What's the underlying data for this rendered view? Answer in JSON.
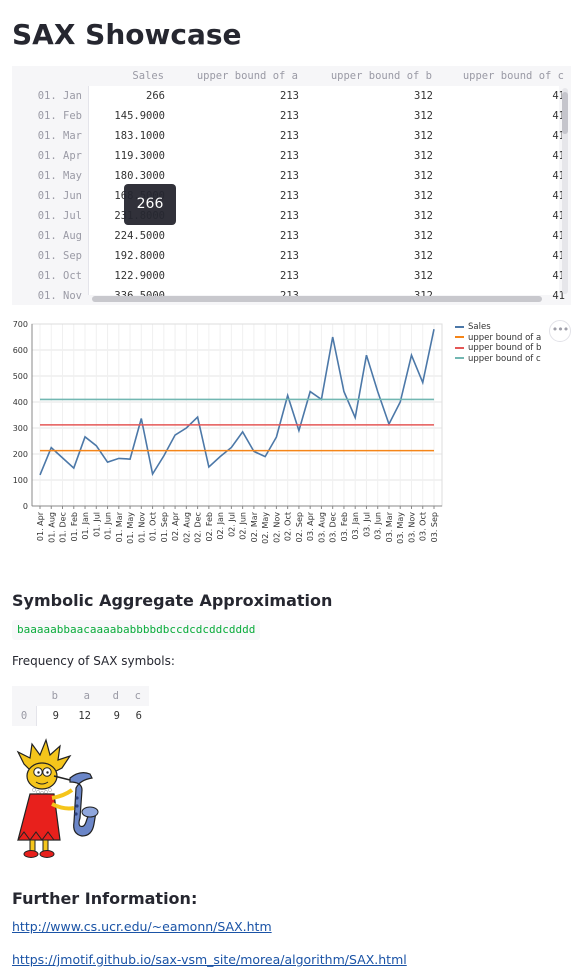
{
  "page": {
    "title": "SAX Showcase"
  },
  "dataframe": {
    "columns": [
      "Sales",
      "upper bound of a",
      "upper bound of b",
      "upper bound of c"
    ],
    "rows": [
      {
        "index": "01. Jan",
        "cells": [
          "266",
          "213",
          "312",
          "41"
        ]
      },
      {
        "index": "01. Feb",
        "cells": [
          "145.9000",
          "213",
          "312",
          "41"
        ]
      },
      {
        "index": "01. Mar",
        "cells": [
          "183.1000",
          "213",
          "312",
          "41"
        ]
      },
      {
        "index": "01. Apr",
        "cells": [
          "119.3000",
          "213",
          "312",
          "41"
        ]
      },
      {
        "index": "01. May",
        "cells": [
          "180.3000",
          "213",
          "312",
          "41"
        ]
      },
      {
        "index": "01. Jun",
        "cells": [
          "168.5000",
          "213",
          "312",
          "41"
        ]
      },
      {
        "index": "01. Jul",
        "cells": [
          "231.8000",
          "213",
          "312",
          "41"
        ]
      },
      {
        "index": "01. Aug",
        "cells": [
          "224.5000",
          "213",
          "312",
          "41"
        ]
      },
      {
        "index": "01. Sep",
        "cells": [
          "192.8000",
          "213",
          "312",
          "41"
        ]
      },
      {
        "index": "01. Oct",
        "cells": [
          "122.9000",
          "213",
          "312",
          "41"
        ]
      },
      {
        "index": "01. Nov",
        "cells": [
          "336.5000",
          "213",
          "312",
          "41"
        ]
      }
    ],
    "tooltip": "266"
  },
  "chart_data": {
    "type": "line",
    "x": [
      "01. Jan",
      "01. Feb",
      "01. Mar",
      "01. Apr",
      "01. May",
      "01. Jun",
      "01. Jul",
      "01. Aug",
      "01. Sep",
      "01. Oct",
      "01. Nov",
      "01. Dec",
      "02. Jan",
      "02. Feb",
      "02. Mar",
      "02. Apr",
      "02. May",
      "02. Jun",
      "02. Jul",
      "02. Aug",
      "02. Sep",
      "02. Oct",
      "02. Nov",
      "02. Dec",
      "03. Jan",
      "03. Feb",
      "03. Mar",
      "03. Apr",
      "03. May",
      "03. Jun",
      "03. Jul",
      "03. Aug",
      "03. Sep",
      "03. Oct",
      "03. Nov",
      "03. Dec"
    ],
    "xtick_labels": [
      "01. Apr",
      "01. Aug",
      "01. Dec",
      "01. Feb",
      "01. Jan",
      "01. Jul",
      "01. Jun",
      "01. Mar",
      "01. May",
      "01. Nov",
      "01. Oct",
      "01. Sep",
      "02. Apr",
      "02. Aug",
      "02. Dec",
      "02. Feb",
      "02. Jan",
      "02. Jul",
      "02. Jun",
      "02. Mar",
      "02. May",
      "02. Nov",
      "02. Oct",
      "02. Sep",
      "03. Apr",
      "03. Aug",
      "03. Dec",
      "03. Feb",
      "03. Jan",
      "03. Jul",
      "03. Jun",
      "03. Mar",
      "03. May",
      "03. Nov",
      "03. Oct",
      "03. Sep"
    ],
    "ylim": [
      0,
      700
    ],
    "yticks": [
      0,
      100,
      200,
      300,
      400,
      500,
      600,
      700
    ],
    "grid": true,
    "legend_position": "top-right",
    "series": [
      {
        "name": "Sales",
        "color": "#4c78a8",
        "values": [
          119.3,
          224.5,
          185,
          145.9,
          266,
          231.8,
          168.5,
          183.1,
          180.3,
          336.5,
          122.9,
          192.8,
          273,
          300,
          342,
          150,
          190,
          225,
          285,
          210,
          190,
          265,
          425,
          290,
          440,
          410,
          650,
          440,
          340,
          580,
          440,
          315,
          400,
          580,
          475,
          680
        ]
      },
      {
        "name": "upper bound of a",
        "color": "#f58518",
        "values": [
          213
        ]
      },
      {
        "name": "upper bound of b",
        "color": "#e45756",
        "values": [
          312
        ]
      },
      {
        "name": "upper bound of c",
        "color": "#72b7b2",
        "values": [
          410
        ]
      }
    ]
  },
  "sax": {
    "heading": "Symbolic Aggregate Approximation",
    "string": "baaaaabbaacaaaababbbbdbccdcdcddcdddd",
    "freq_label": "Frequency of SAX symbols:",
    "freq_table": {
      "columns": [
        "b",
        "a",
        "d",
        "c"
      ],
      "index": "0",
      "values": [
        "9",
        "12",
        "9",
        "6"
      ]
    }
  },
  "further": {
    "heading": "Further Information:",
    "links": [
      "http://www.cs.ucr.edu/~eamonn/SAX.htm",
      "https://jmotif.github.io/sax-vsm_site/morea/algorithm/SAX.html"
    ]
  },
  "image": {
    "name": "lisa-saxophone-illustration"
  },
  "icons": {
    "chart_menu": "more-horizontal-icon"
  }
}
